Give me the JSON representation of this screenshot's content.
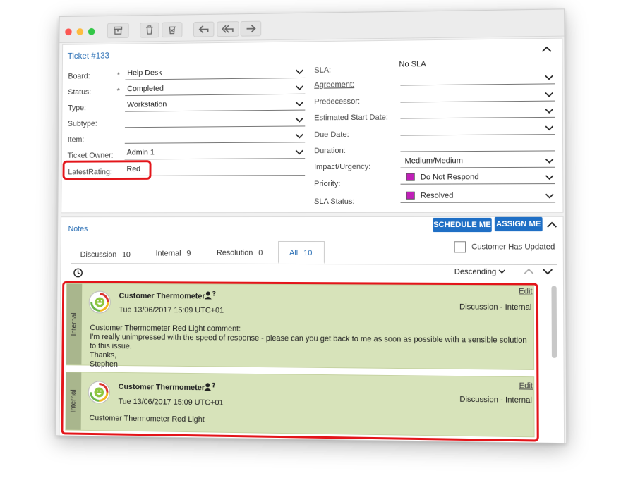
{
  "ticket": {
    "title": "Ticket #133"
  },
  "fields_left": [
    {
      "label": "Board:",
      "required": "*",
      "value": "Help Desk"
    },
    {
      "label": "Status:",
      "required": "*",
      "value": "Completed"
    },
    {
      "label": "Type:",
      "required": "",
      "value": "Workstation"
    },
    {
      "label": "Subtype:",
      "required": "",
      "value": ""
    },
    {
      "label": "Item:",
      "required": "",
      "value": ""
    },
    {
      "label": "Ticket Owner:",
      "required": "",
      "value": "Admin 1"
    },
    {
      "label": "LatestRating:",
      "required": "",
      "value": "Red"
    }
  ],
  "fields_right": [
    {
      "label": "SLA:",
      "value": "No SLA"
    },
    {
      "label": "Agreement:",
      "value": ""
    },
    {
      "label": "Predecessor:",
      "value": ""
    },
    {
      "label": "Estimated Start Date:",
      "value": ""
    },
    {
      "label": "Due Date:",
      "value": ""
    },
    {
      "label": "Duration:",
      "value": ""
    },
    {
      "label": "Impact/Urgency:",
      "value": "Medium/Medium"
    },
    {
      "label": "Priority:",
      "value": "Do Not Respond",
      "swatch": "#c020b8"
    },
    {
      "label": "SLA Status:",
      "value": "Resolved",
      "swatch": "#c020b8"
    }
  ],
  "notes": {
    "title": "Notes",
    "schedule_label": "SCHEDULE ME",
    "assign_label": "ASSIGN ME",
    "customer_updated_label": "Customer Has Updated",
    "sort_label": "Descending",
    "tabs": [
      {
        "label": "Discussion",
        "count": "10"
      },
      {
        "label": "Internal",
        "count": "9"
      },
      {
        "label": "Resolution",
        "count": "0"
      },
      {
        "label": "All",
        "count": "10"
      }
    ],
    "items": [
      {
        "side": "Internal",
        "author": "Customer Thermometer",
        "date": "Tue 13/06/2017 15:09 UTC+01",
        "edit": "Edit",
        "kind": "Discussion - Internal",
        "lines": [
          "Customer Thermometer  Red Light comment:",
          "I'm really unimpressed with the speed of response - please can you get back to me as soon as possible with a sensible solution",
          "to this issue.",
          "Thanks,",
          "Stephen"
        ]
      },
      {
        "side": "Internal",
        "author": "Customer Thermometer",
        "date": "Tue 13/06/2017 15:09 UTC+01",
        "edit": "Edit",
        "kind": "Discussion - Internal",
        "lines": [
          "Customer Thermometer  Red Light"
        ]
      }
    ]
  },
  "colors": {
    "accent": "#1f6fc5",
    "highlight": "#e3151a",
    "note_bg": "#d7e3ba",
    "swatch": "#c020b8"
  },
  "icons": {
    "toolbar": [
      "archive-icon",
      "trash-icon",
      "delete-all-icon",
      "reply-icon",
      "reply-all-icon",
      "forward-icon"
    ],
    "other": [
      "chevron-up-icon",
      "chevron-down-icon",
      "clock-icon",
      "user-question-icon",
      "smiley-avatar-icon"
    ]
  }
}
